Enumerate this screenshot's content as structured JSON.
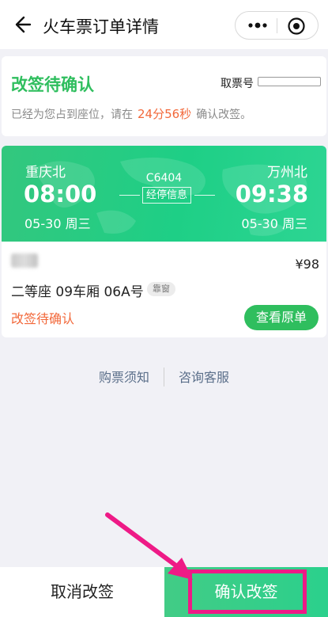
{
  "nav": {
    "title": "火车票订单详情",
    "back_icon": "back-arrow-icon",
    "more_icon": "more-dots-icon",
    "close_icon": "target-close-icon"
  },
  "status": {
    "title": "改签待确认",
    "ticket_no_label": "取票号",
    "hold_prefix": "已经为您占到座位，请在",
    "countdown": "24分56秒",
    "hold_suffix": "确认改签。"
  },
  "trip": {
    "from_station": "重庆北",
    "to_station": "万州北",
    "dep_time": "08:00",
    "arr_time": "09:38",
    "dep_date": "05-30 周三",
    "arr_date": "05-30 周三",
    "train_no": "C6404",
    "stops_label": "经停信息"
  },
  "passenger": {
    "price": "¥98",
    "seat": "二等座  09车厢 06A号",
    "seat_tag": "靠窗",
    "status": "改签待确认",
    "view_original_label": "查看原单"
  },
  "links": {
    "notice": "购票须知",
    "service": "咨询客服"
  },
  "footer": {
    "cancel_label": "取消改签",
    "confirm_label": "确认改签"
  },
  "colors": {
    "accent_green": "#2fbe5e",
    "warning_orange": "#f2683a",
    "highlight_pink": "#ee1a86"
  }
}
